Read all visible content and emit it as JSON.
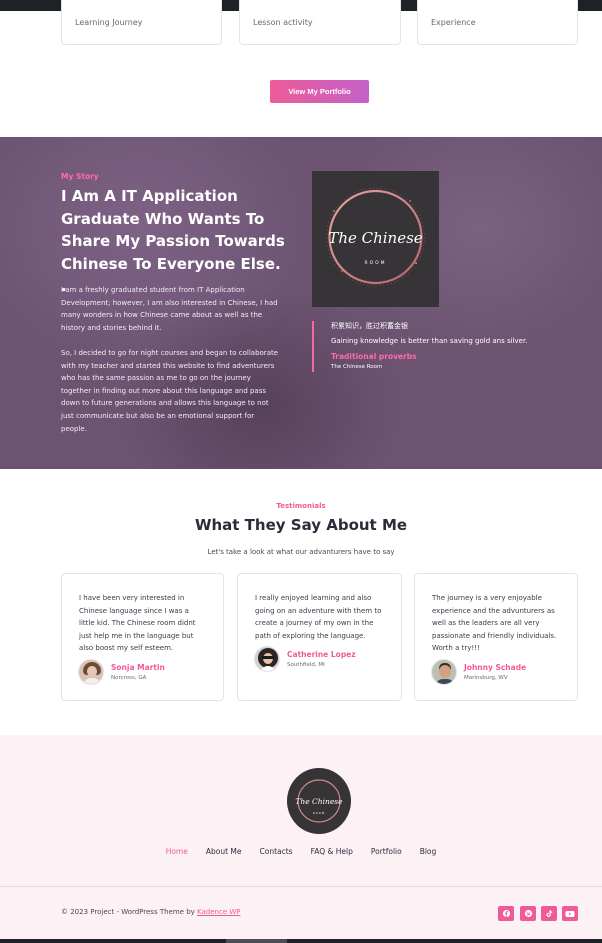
{
  "top_cards": [
    {
      "label": "Learning Journey"
    },
    {
      "label": "Lesson activity"
    },
    {
      "label": "Experience"
    }
  ],
  "portfolio_button": "View My Portfolio",
  "story": {
    "eyebrow": "My Story",
    "title": "I Am A IT Application Graduate Who Wants To Share My Passion Towards Chinese To Everyone Else. .",
    "p1": "I am a freshly graduated student from IT Application Development; however, I am also interested in Chinese, I had many wonders in how Chinese came about as well as the history and stories behind it.",
    "p2": "So, I decided to go for night courses and began to collaborate with my teacher and started this website to find adventurers who has the same passion as me to go on the journey together in finding out more about this language and pass down to future generations and allows this language to not just communicate but also be an emotional support for people.",
    "logo_text_main": "The Chinese",
    "logo_text_sub": "ROOM",
    "quote_cn": "积累知识，胜过积蓄金银",
    "quote_en": "Gaining knowledge is better than saving gold ans silver.",
    "quote_label": "Traditional proverbs",
    "quote_source": "The Chinese Room"
  },
  "testimonials": {
    "eyebrow": "Testimonials",
    "title": "What They Say About Me",
    "subtitle": "Let's take a look at what our advanturers have to say",
    "items": [
      {
        "text": "I have been very interested in Chinese language since I was a little kid. The Chinese room didnt just help me in the language but also boost my self esteem.",
        "name": "Sonja Martin",
        "location": "Norcross, GA"
      },
      {
        "text": "I really enjoyed learning and also going on an adventure with them to create a journey of my own in the path of exploring the language.",
        "name": "Catherine Lopez",
        "location": "Southfield, MI"
      },
      {
        "text": "The journey is a very enjoyable experience and the advunturers as well as the leaders are all very passionate and friendly individuals. Worth a try!!!",
        "name": "Johnny Schade",
        "location": "Marinsburg, WV"
      }
    ]
  },
  "footer": {
    "logo_text_main": "The Chinese",
    "logo_text_sub": "ROOM",
    "nav": [
      "Home",
      "About Me",
      "Contacts",
      "FAQ & Help",
      "Portfolio",
      "Blog"
    ],
    "copyright_prefix": "© 2023 Project - WordPress Theme by ",
    "copyright_link": "Kadence WP",
    "social": [
      "facebook-icon",
      "pinterest-icon",
      "tiktok-icon",
      "youtube-icon"
    ]
  },
  "colors": {
    "accent": "#ef5b98",
    "story_bg": "#6c5372",
    "footer_bg": "#fcf2f6"
  }
}
